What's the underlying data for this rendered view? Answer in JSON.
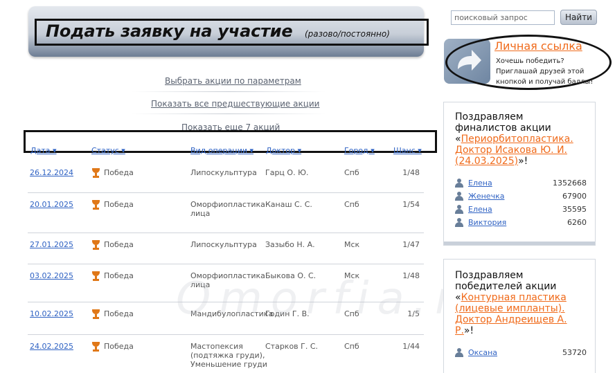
{
  "banner": {
    "title": "Подать заявку на участие",
    "subtitle": "(разово/постоянно)"
  },
  "nav": {
    "filter": "Выбрать акции по параметрам",
    "all_previous": "Показать все предшествующие акции",
    "more": "Показать еще 7 акций"
  },
  "columns": {
    "date": "Дата ▾",
    "status": "Статус ▾",
    "operation": "Вид операции ▾",
    "doctor": "Доктор ▾",
    "city": "Город ▾",
    "chance": "Шанс ▾"
  },
  "rows": [
    {
      "date": "26.12.2024",
      "status": "Победа",
      "op1": "Липоскульптура",
      "op2": "",
      "op3": "",
      "doctor": "Гарц О. Ю.",
      "city": "Спб",
      "chance": "1/48"
    },
    {
      "date": "20.01.2025",
      "status": "Победа",
      "op1": "Оморфиопластика",
      "op2": "лица",
      "op3": "",
      "doctor": "Канаш С. С.",
      "city": "Спб",
      "chance": "1/54"
    },
    {
      "date": "27.01.2025",
      "status": "Победа",
      "op1": "Липоскульптура",
      "op2": "",
      "op3": "",
      "doctor": "Зазыбо Н. А.",
      "city": "Мск",
      "chance": "1/47"
    },
    {
      "date": "03.02.2025",
      "status": "Победа",
      "op1": "Оморфиопластика",
      "op2": "лица",
      "op3": "",
      "doctor": "Быкова О. С.",
      "city": "Мск",
      "chance": "1/48"
    },
    {
      "date": "10.02.2025",
      "status": "Победа",
      "op1": "Мандибулопластика",
      "op2": "",
      "op3": "",
      "doctor": "Годин Г. В.",
      "city": "Спб",
      "chance": "1/5"
    },
    {
      "date": "24.02.2025",
      "status": "Победа",
      "op1": "Мастопексия",
      "op2": "(подтяжка груди),",
      "op3": "Уменьшение груди",
      "doctor": "Старков Г. С.",
      "city": "Спб",
      "chance": "1/44"
    }
  ],
  "watermark": "Omorfia.ru",
  "search": {
    "placeholder": "поисковый запрос",
    "button": "Найти"
  },
  "personal_link": {
    "title": "Личная ссылка",
    "line1": "Хочешь победить?",
    "line2": "Приглашай друзей этой",
    "line3": "кнопкой и получай баллы!"
  },
  "finalists": {
    "head1": "Поздравляем",
    "head2": "финалистов акции",
    "link1": "Периорбитопластика.",
    "link2": "Доктор Исакова Ю. И.",
    "link3": "(24.03.2025)",
    "tail": "»!",
    "people": [
      {
        "name": "Елена",
        "score": "1352668"
      },
      {
        "name": "Женечка",
        "score": "67900"
      },
      {
        "name": "Елена",
        "score": "35595"
      },
      {
        "name": "Виктория",
        "score": "6260"
      }
    ]
  },
  "winners": {
    "head1": "Поздравляем",
    "head2": "победителей акции",
    "link1": "Контурная пластика",
    "link2": "(лицевые импланты).",
    "link3": "Доктор Андреищев А.",
    "link4": "Р.",
    "tail": "»!",
    "people": [
      {
        "name": "Оксана",
        "score": "53720"
      }
    ]
  },
  "colors": {
    "accent": "#2f62c3",
    "orange": "#f06a1a"
  }
}
